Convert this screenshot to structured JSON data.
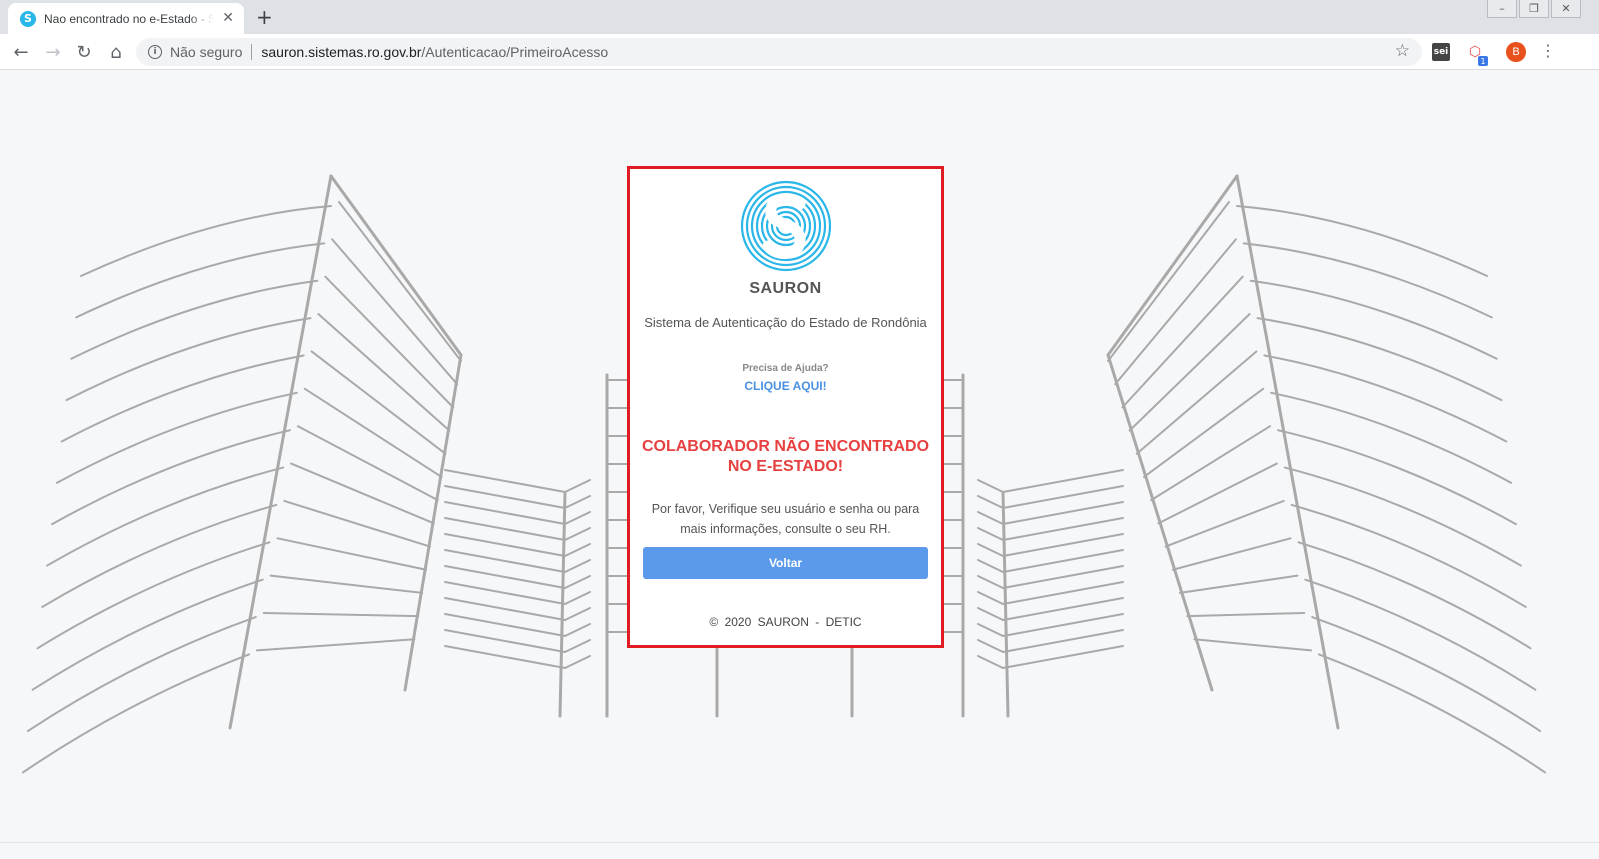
{
  "browser": {
    "tab_title": "Nao encontrado no e-Estado - SAURON",
    "tab_favicon_letter": "S",
    "new_tab_label": "+",
    "security_label": "Não seguro",
    "url_host": "sauron.sistemas.ro.gov.br",
    "url_path": "/Autenticacao/PrimeiroAcesso",
    "extensions": [
      "sei",
      "share-extension"
    ],
    "sei_label": "sei",
    "ext_badge": "1",
    "profile_initial": "B"
  },
  "card": {
    "app_name": "SAURON",
    "subtitle": "Sistema de Autenticação do Estado de Rondônia",
    "help_question": "Precisa de Ajuda?",
    "help_link": "CLIQUE AQUI!",
    "error_title": "COLABORADOR NÃO ENCONTRADO NO E-ESTADO!",
    "error_message": "Por favor, Verifique seu usuário e senha ou para mais informações, consulte o seu RH.",
    "back_button": "Voltar",
    "footer": "© 2020 SAURON - DETIC"
  },
  "colors": {
    "highlight_border": "#e01b24",
    "error_text": "#e64040",
    "primary_button": "#5b9aea",
    "link": "#4a90e2",
    "logo": "#29b6e8"
  }
}
